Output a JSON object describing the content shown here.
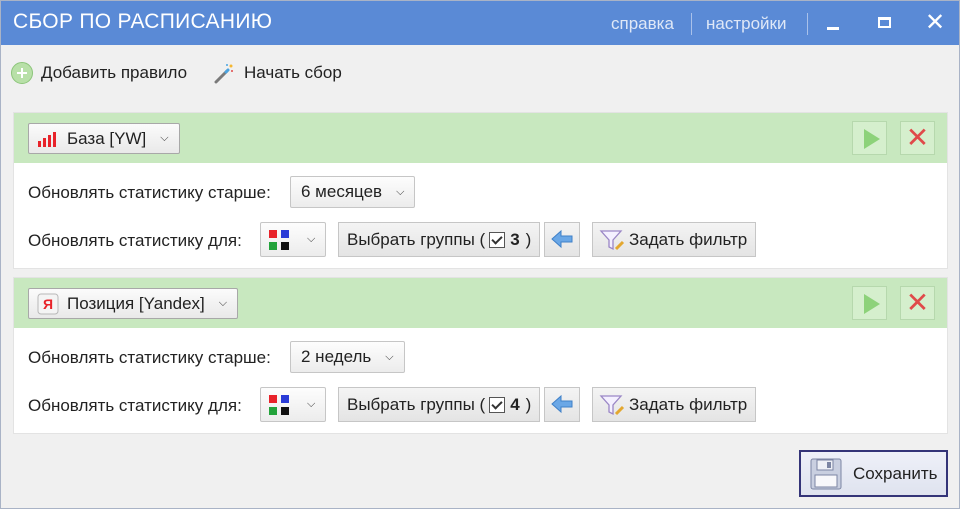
{
  "window": {
    "title": "СБОР ПО РАСПИСАНИЮ",
    "help_link": "справка",
    "settings_link": "настройки",
    "close_glyph": "✕"
  },
  "toolbar": {
    "add_rule": "Добавить правило",
    "start_collect": "Начать сбор"
  },
  "rules": [
    {
      "source": "База [YW]",
      "source_icon": "bar-chart-icon",
      "older_label": "Обновлять статистику старше:",
      "older_value": "6 месяцев",
      "for_label": "Обновлять статистику для:",
      "groups_label": "Выбрать группы (",
      "groups_count": "3",
      "groups_close": ")",
      "filter_label": "Задать фильтр"
    },
    {
      "source": "Позиция [Yandex]",
      "source_icon": "yandex-icon",
      "older_label": "Обновлять статистику старше:",
      "older_value": "2 недель",
      "for_label": "Обновлять статистику для:",
      "groups_label": "Выбрать группы (",
      "groups_count": "4",
      "groups_close": ")",
      "filter_label": "Задать фильтр"
    }
  ],
  "footer": {
    "save": "Сохранить"
  },
  "colors": {
    "titlebar": "#5a8ad6",
    "rule_header": "#c8e8bf",
    "play": "#8dd27a",
    "delete": "#e04a4a",
    "color_squares": [
      "#e8232a",
      "#2a3bd6",
      "#23a33b",
      "#111111"
    ]
  }
}
